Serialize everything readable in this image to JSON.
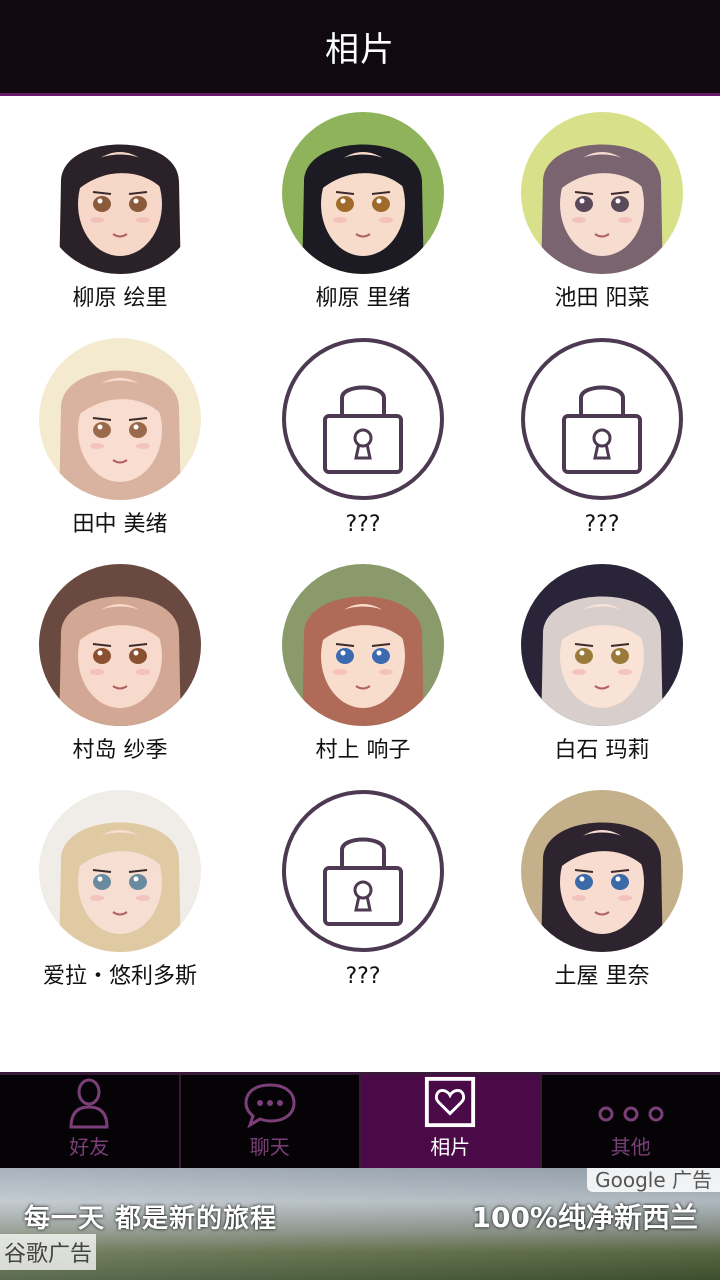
{
  "header": {
    "title": "相片"
  },
  "photos": [
    {
      "name": "柳原 绘里",
      "locked": false,
      "skin": "#f6d7c8",
      "hair": "#2a2228",
      "bg": "#ffffff",
      "eye": "#8a5a3a"
    },
    {
      "name": "柳原 里绪",
      "locked": false,
      "skin": "#f7dccb",
      "hair": "#1c1a22",
      "bg": "#8fb35a",
      "eye": "#a06a2a"
    },
    {
      "name": "池田 阳菜",
      "locked": false,
      "skin": "#f7dcd0",
      "hair": "#7a6470",
      "bg": "#d8e08a",
      "eye": "#5a4a5a"
    },
    {
      "name": "田中 美绪",
      "locked": false,
      "skin": "#f9ddd0",
      "hair": "#d9b2a0",
      "bg": "#f4ead0",
      "eye": "#9a6a4a"
    },
    {
      "name": "???",
      "locked": true
    },
    {
      "name": "???",
      "locked": true
    },
    {
      "name": "村岛 纱季",
      "locked": false,
      "skin": "#f7dacb",
      "hair": "#d2a894",
      "bg": "#6a4a40",
      "eye": "#8a5030"
    },
    {
      "name": "村上 响子",
      "locked": false,
      "skin": "#f8dccc",
      "hair": "#b06a58",
      "bg": "#8a9a6a",
      "eye": "#3a6ab0"
    },
    {
      "name": "白石 玛莉",
      "locked": false,
      "skin": "#f9e2d6",
      "hair": "#d8cfcc",
      "bg": "#2a2438",
      "eye": "#9a7a3a"
    },
    {
      "name": "爱拉・悠利多斯",
      "locked": false,
      "skin": "#f7ded2",
      "hair": "#e0caa4",
      "bg": "#f0ece8",
      "eye": "#6a8aa0"
    },
    {
      "name": "???",
      "locked": true
    },
    {
      "name": "土屋 里奈",
      "locked": false,
      "skin": "#f8dcd0",
      "hair": "#2e2430",
      "bg": "#c4b08a",
      "eye": "#3a6aa8"
    }
  ],
  "tabs": [
    {
      "label": "好友",
      "icon": "person-icon",
      "active": false
    },
    {
      "label": "聊天",
      "icon": "chat-bubble-icon",
      "active": false
    },
    {
      "label": "相片",
      "icon": "photo-heart-icon",
      "active": true
    },
    {
      "label": "其他",
      "icon": "more-dots-icon",
      "active": false
    }
  ],
  "ad": {
    "slogan": "每一天  都是新的旅程",
    "promo": "100%纯净新西兰",
    "badge": "Google 广告",
    "label": "谷歌广告"
  },
  "colors": {
    "accent": "#4a0a48",
    "lock": "#4d3a52",
    "inactive_tab": "#7a3f78"
  }
}
